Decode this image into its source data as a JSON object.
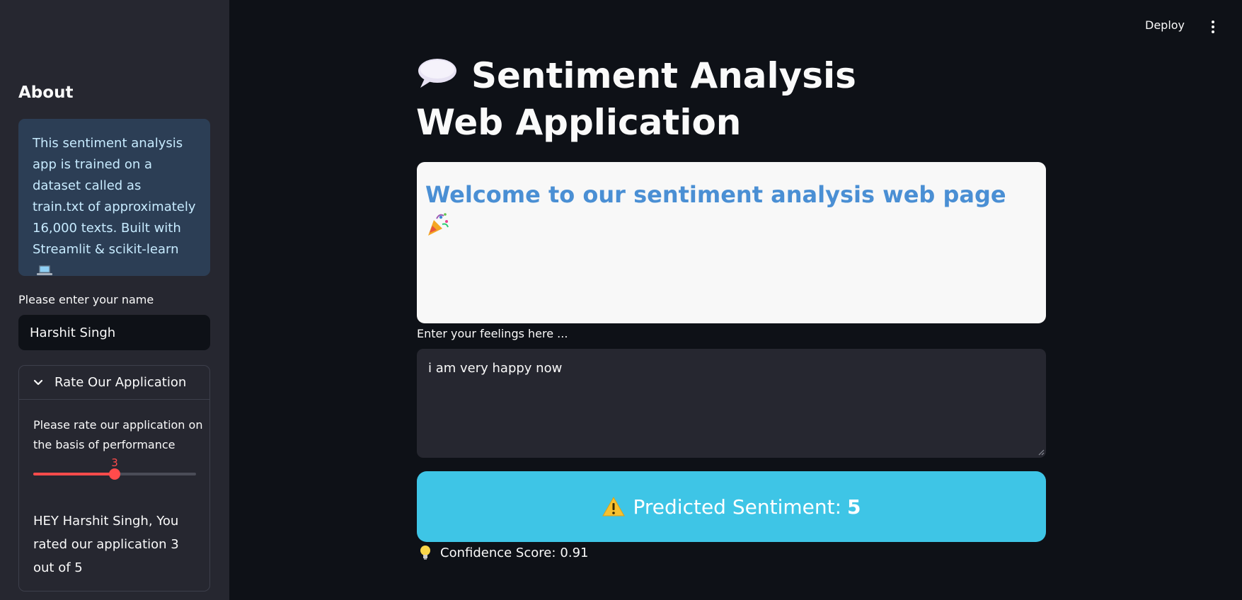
{
  "header": {
    "deploy_label": "Deploy",
    "menu_icon": "vertical-ellipsis-icon"
  },
  "sidebar": {
    "heading": "About",
    "about_text": "This sentiment analysis app is trained on a dataset called as train.txt of approximately 16,000 texts. Built with Streamlit & scikit-learn",
    "about_icon": "laptop-icon",
    "name_label": "Please enter your name",
    "name_value": "Harshit Singh",
    "expander": {
      "title": "Rate Our Application",
      "icon": "chevron-down-icon",
      "rate_label": "Please rate our application on the basis of performance",
      "slider": {
        "value": "3",
        "min": 1,
        "max": 5,
        "fraction": 0.5
      },
      "rating_message": "HEY Harshit Singh, You rated our application 3 out of 5"
    }
  },
  "main": {
    "title": "Sentiment Analysis Web Application",
    "title_icon": "speech-balloon-icon",
    "welcome_text": "Welcome to our sentiment analysis web page",
    "welcome_icon": "party-popper-icon",
    "feelings_label": "Enter your feelings here ...",
    "feelings_value": "i am very happy now",
    "prediction_label": "Predicted Sentiment:",
    "prediction_value": "5",
    "prediction_icon": "warning-icon",
    "confidence_label": "Confidence Score:",
    "confidence_value": "0.91",
    "confidence_icon": "lightbulb-icon"
  },
  "colors": {
    "background": "#0e1117",
    "sidebar": "#262730",
    "info_box": "#2c3e55",
    "accent": "#ff4b4b",
    "prediction_box": "#3ec5e6",
    "welcome_text": "#4a8fd4"
  }
}
